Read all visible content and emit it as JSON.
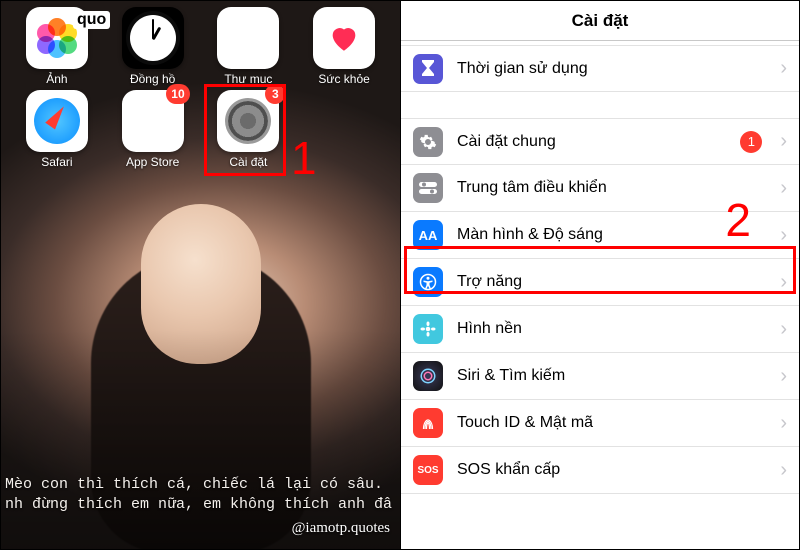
{
  "left": {
    "quo_tag": "quo",
    "apps": [
      {
        "label": "Ảnh",
        "name": "photos"
      },
      {
        "label": "Đồng hồ",
        "name": "clock"
      },
      {
        "label": "Thư mục",
        "name": "folder"
      },
      {
        "label": "Sức khỏe",
        "name": "health"
      },
      {
        "label": "Safari",
        "name": "safari"
      },
      {
        "label": "App Store",
        "name": "appstore",
        "badge": "10"
      },
      {
        "label": "Cài đặt",
        "name": "settings",
        "badge": "3"
      }
    ],
    "caption_line1": "Mèo con thì thích cá, chiếc lá lại có sâu.",
    "caption_line2": "nh đừng thích em nữa, em không thích anh đâ",
    "credit": "@iamotp.quotes",
    "annot_number": "1"
  },
  "right": {
    "title": "Cài đặt",
    "annot_number": "2",
    "group1": [
      {
        "label": "Thời gian sử dụng"
      }
    ],
    "group2": [
      {
        "label": "Cài đặt chung",
        "badge": "1"
      },
      {
        "label": "Trung tâm điều khiển"
      },
      {
        "label": "Màn hình & Độ sáng"
      },
      {
        "label": "Trợ năng"
      },
      {
        "label": "Hình nền"
      },
      {
        "label": "Siri & Tìm kiếm"
      },
      {
        "label": "Touch ID & Mật mã"
      },
      {
        "label": "SOS khẩn cấp"
      }
    ]
  }
}
